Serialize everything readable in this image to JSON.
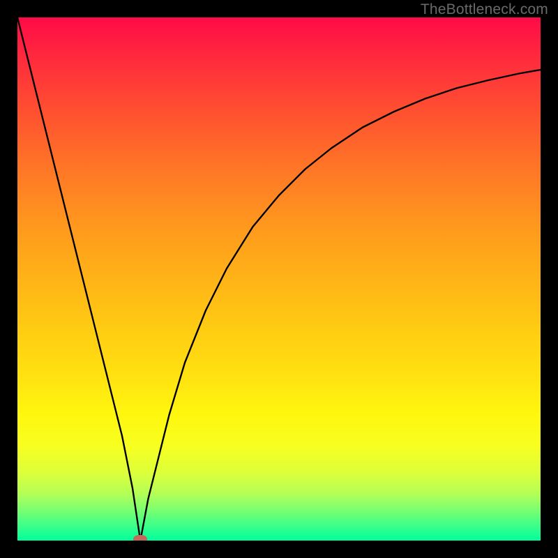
{
  "watermark": "TheBottleneck.com",
  "chart_data": {
    "type": "line",
    "title": "",
    "xlabel": "",
    "ylabel": "",
    "xlim": [
      0,
      100
    ],
    "ylim": [
      0,
      100
    ],
    "grid": false,
    "legend": false,
    "series": [
      {
        "name": "curve",
        "x": [
          0,
          2,
          4,
          6,
          8,
          10,
          12,
          14,
          16,
          18,
          20,
          22,
          23.5,
          25,
          27,
          29,
          32,
          36,
          40,
          45,
          50,
          55,
          60,
          66,
          72,
          78,
          84,
          90,
          96,
          100
        ],
        "values": [
          100,
          92,
          84,
          76,
          68,
          60,
          52,
          44,
          36,
          28,
          20,
          10,
          0,
          8,
          16,
          24,
          34,
          44,
          52,
          60,
          66,
          71,
          75,
          79,
          82,
          84.5,
          86.5,
          88,
          89.3,
          90
        ]
      }
    ],
    "min_marker": {
      "x": 23.5,
      "y": 0
    },
    "gradient_stops": [
      {
        "pos": 0,
        "color": "#ff0a47"
      },
      {
        "pos": 50,
        "color": "#ffc813"
      },
      {
        "pos": 80,
        "color": "#fff70f"
      },
      {
        "pos": 100,
        "color": "#00ff9c"
      }
    ]
  }
}
